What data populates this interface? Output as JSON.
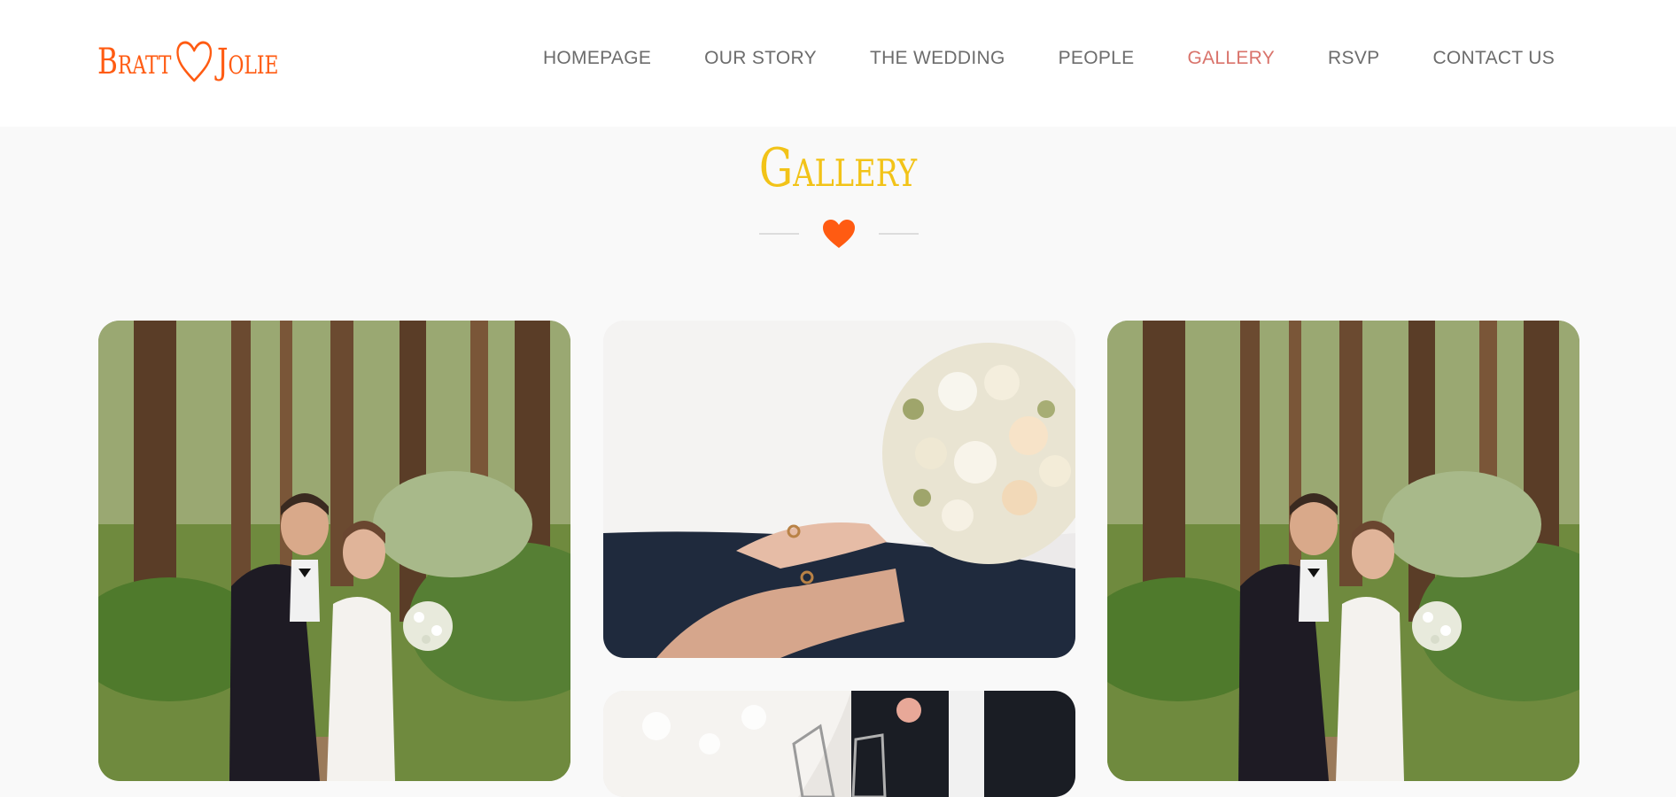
{
  "logo": {
    "left_name": "Bratt",
    "right_name": "Jolie",
    "color": "#ff5b12",
    "icon": "heart-outline-icon"
  },
  "nav": {
    "items": [
      {
        "label": "HOMEPAGE"
      },
      {
        "label": "OUR STORY"
      },
      {
        "label": "THE WEDDING"
      },
      {
        "label": "PEOPLE"
      },
      {
        "label": "GALLERY"
      },
      {
        "label": "RSVP"
      },
      {
        "label": "CONTACT US"
      }
    ],
    "active_index": 4,
    "text_color": "#6c6c6c",
    "active_color": "#d9736b"
  },
  "section": {
    "title": "Gallery",
    "title_color": "#f2c318",
    "divider_icon": "heart-icon",
    "divider_color": "#ff5b12"
  },
  "gallery": {
    "photos": [
      {
        "subject": "couple-in-forest"
      },
      {
        "subject": "hands-with-rings-and-bouquet"
      },
      {
        "subject": "champagne-glasses"
      },
      {
        "subject": "couple-in-forest"
      }
    ]
  }
}
